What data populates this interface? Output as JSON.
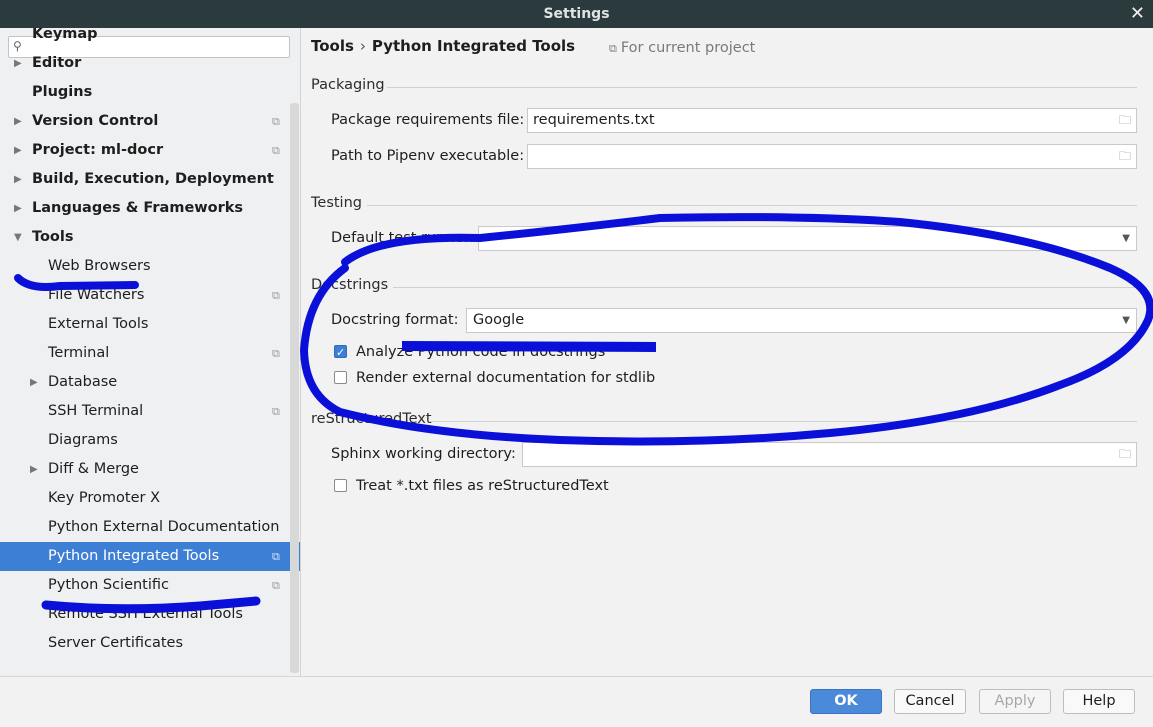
{
  "window": {
    "title": "Settings",
    "close_label": "✕"
  },
  "search": {
    "placeholder": ""
  },
  "sidebar": {
    "items": [
      {
        "label": "Keymap",
        "bold": true,
        "arrow": false,
        "indent": 0,
        "proj": false
      },
      {
        "label": "Editor",
        "bold": true,
        "arrow": "right",
        "indent": 0,
        "proj": false
      },
      {
        "label": "Plugins",
        "bold": true,
        "arrow": false,
        "indent": 0,
        "proj": false
      },
      {
        "label": "Version Control",
        "bold": true,
        "arrow": "right",
        "indent": 0,
        "proj": true
      },
      {
        "label": "Project: ml-docr",
        "bold": true,
        "arrow": "right",
        "indent": 0,
        "proj": true
      },
      {
        "label": "Build, Execution, Deployment",
        "bold": true,
        "arrow": "right",
        "indent": 0,
        "proj": false
      },
      {
        "label": "Languages & Frameworks",
        "bold": true,
        "arrow": "right",
        "indent": 0,
        "proj": false
      },
      {
        "label": "Tools",
        "bold": true,
        "arrow": "down",
        "indent": 0,
        "proj": false
      },
      {
        "label": "Web Browsers",
        "bold": false,
        "arrow": false,
        "indent": 1,
        "proj": false
      },
      {
        "label": "File Watchers",
        "bold": false,
        "arrow": false,
        "indent": 1,
        "proj": true
      },
      {
        "label": "External Tools",
        "bold": false,
        "arrow": false,
        "indent": 1,
        "proj": false
      },
      {
        "label": "Terminal",
        "bold": false,
        "arrow": false,
        "indent": 1,
        "proj": true
      },
      {
        "label": "Database",
        "bold": false,
        "arrow": "right",
        "indent": 1,
        "proj": false
      },
      {
        "label": "SSH Terminal",
        "bold": false,
        "arrow": false,
        "indent": 1,
        "proj": true
      },
      {
        "label": "Diagrams",
        "bold": false,
        "arrow": false,
        "indent": 1,
        "proj": false
      },
      {
        "label": "Diff & Merge",
        "bold": false,
        "arrow": "right",
        "indent": 1,
        "proj": false
      },
      {
        "label": "Key Promoter X",
        "bold": false,
        "arrow": false,
        "indent": 1,
        "proj": false
      },
      {
        "label": "Python External Documentation",
        "bold": false,
        "arrow": false,
        "indent": 1,
        "proj": false
      },
      {
        "label": "Python Integrated Tools",
        "bold": false,
        "arrow": false,
        "indent": 1,
        "proj": true,
        "selected": true
      },
      {
        "label": "Python Scientific",
        "bold": false,
        "arrow": false,
        "indent": 1,
        "proj": true
      },
      {
        "label": "Remote SSH External Tools",
        "bold": false,
        "arrow": false,
        "indent": 1,
        "proj": false
      },
      {
        "label": "Server Certificates",
        "bold": false,
        "arrow": false,
        "indent": 1,
        "proj": false
      }
    ]
  },
  "breadcrumb": {
    "root": "Tools",
    "separator": "›",
    "current": "Python Integrated Tools"
  },
  "project_note": "For current project",
  "packaging": {
    "header": "Packaging",
    "req_label": "Package requirements file:",
    "req_value": "requirements.txt",
    "pipenv_label": "Path to Pipenv executable:",
    "pipenv_value": ""
  },
  "testing": {
    "header": "Testing",
    "runner_label": "Default test runner:",
    "runner_value": ""
  },
  "docstrings": {
    "header": "Docstrings",
    "format_label": "Docstring format:",
    "format_value": "Google",
    "analyze_label": "Analyze Python code in docstrings",
    "analyze_checked": true,
    "render_label": "Render external documentation for stdlib",
    "render_checked": false
  },
  "rest": {
    "header": "reStructuredText",
    "sphinx_label": "Sphinx working directory:",
    "sphinx_value": "",
    "treat_label": "Treat *.txt files as reStructuredText",
    "treat_checked": false
  },
  "footer": {
    "ok": "OK",
    "cancel": "Cancel",
    "apply": "Apply",
    "help": "Help"
  },
  "colors": {
    "selection": "#3e7fd6",
    "annotation": "#0a10d8",
    "titlebar": "#2b3b3d"
  },
  "icons": {
    "search": "search-icon",
    "project": "project-scope-icon",
    "folder": "folder-icon",
    "dropdown": "chevron-down-icon"
  }
}
